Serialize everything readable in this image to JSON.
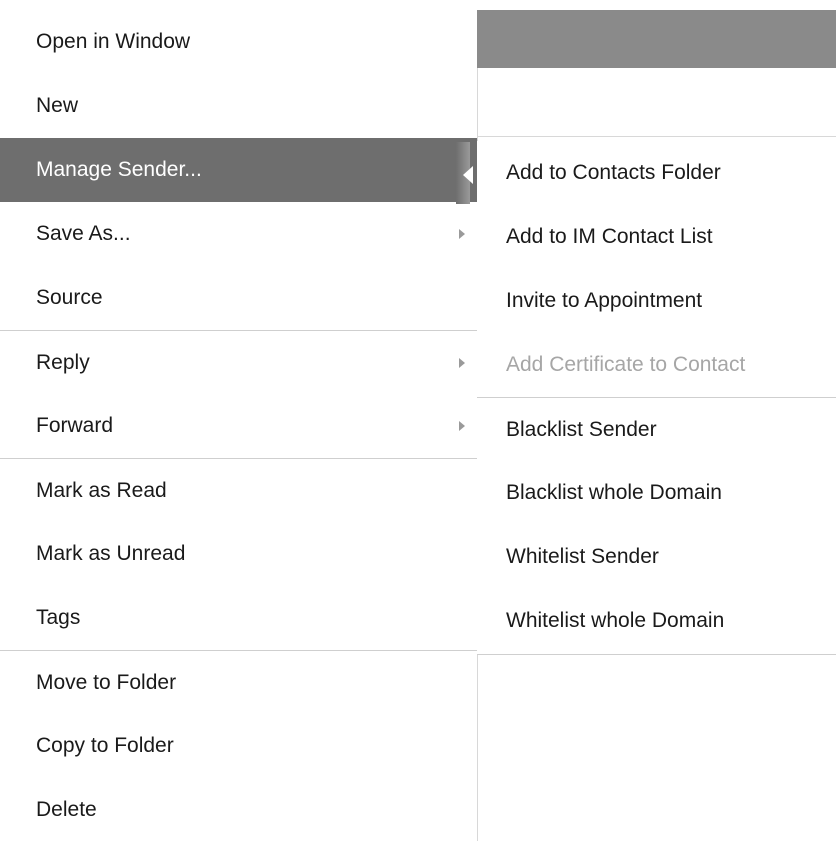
{
  "context_menu": {
    "items": [
      {
        "label": "Open in Window",
        "has_submenu": false,
        "selected": false,
        "separator_above": false
      },
      {
        "label": "New",
        "has_submenu": false,
        "selected": false,
        "separator_above": false
      },
      {
        "label": "Manage Sender...",
        "has_submenu": true,
        "selected": true,
        "separator_above": false
      },
      {
        "label": "Save As...",
        "has_submenu": true,
        "selected": false,
        "separator_above": false
      },
      {
        "label": "Source",
        "has_submenu": false,
        "selected": false,
        "separator_above": false
      },
      {
        "label": "Reply",
        "has_submenu": true,
        "selected": false,
        "separator_above": true
      },
      {
        "label": "Forward",
        "has_submenu": true,
        "selected": false,
        "separator_above": false
      },
      {
        "label": "Mark as Read",
        "has_submenu": false,
        "selected": false,
        "separator_above": true
      },
      {
        "label": "Mark as Unread",
        "has_submenu": false,
        "selected": false,
        "separator_above": false
      },
      {
        "label": "Tags",
        "has_submenu": false,
        "selected": false,
        "separator_above": false
      },
      {
        "label": "Move to Folder",
        "has_submenu": false,
        "selected": false,
        "separator_above": true
      },
      {
        "label": "Copy to Folder",
        "has_submenu": false,
        "selected": false,
        "separator_above": false
      },
      {
        "label": "Delete",
        "has_submenu": false,
        "selected": false,
        "separator_above": false
      }
    ]
  },
  "submenu": {
    "items": [
      {
        "label": "Add to Contacts Folder",
        "disabled": false,
        "separator_above": false
      },
      {
        "label": "Add to IM Contact List",
        "disabled": false,
        "separator_above": false
      },
      {
        "label": "Invite to Appointment",
        "disabled": false,
        "separator_above": false
      },
      {
        "label": "Add Certificate to Contact",
        "disabled": true,
        "separator_above": false
      },
      {
        "label": "Blacklist Sender",
        "disabled": false,
        "separator_above": true
      },
      {
        "label": "Blacklist whole Domain",
        "disabled": false,
        "separator_above": false
      },
      {
        "label": "Whitelist Sender",
        "disabled": false,
        "separator_above": false
      },
      {
        "label": "Whitelist whole Domain",
        "disabled": false,
        "separator_above": false
      }
    ]
  },
  "colors": {
    "selected_bg": "#6e6e6e",
    "selected_text": "#ffffff",
    "text": "#1a1a1a",
    "disabled_text": "#a6a6a6",
    "separator": "#cfcfcf"
  },
  "icons": {
    "submenu_arrow": "chevron-right-icon"
  }
}
